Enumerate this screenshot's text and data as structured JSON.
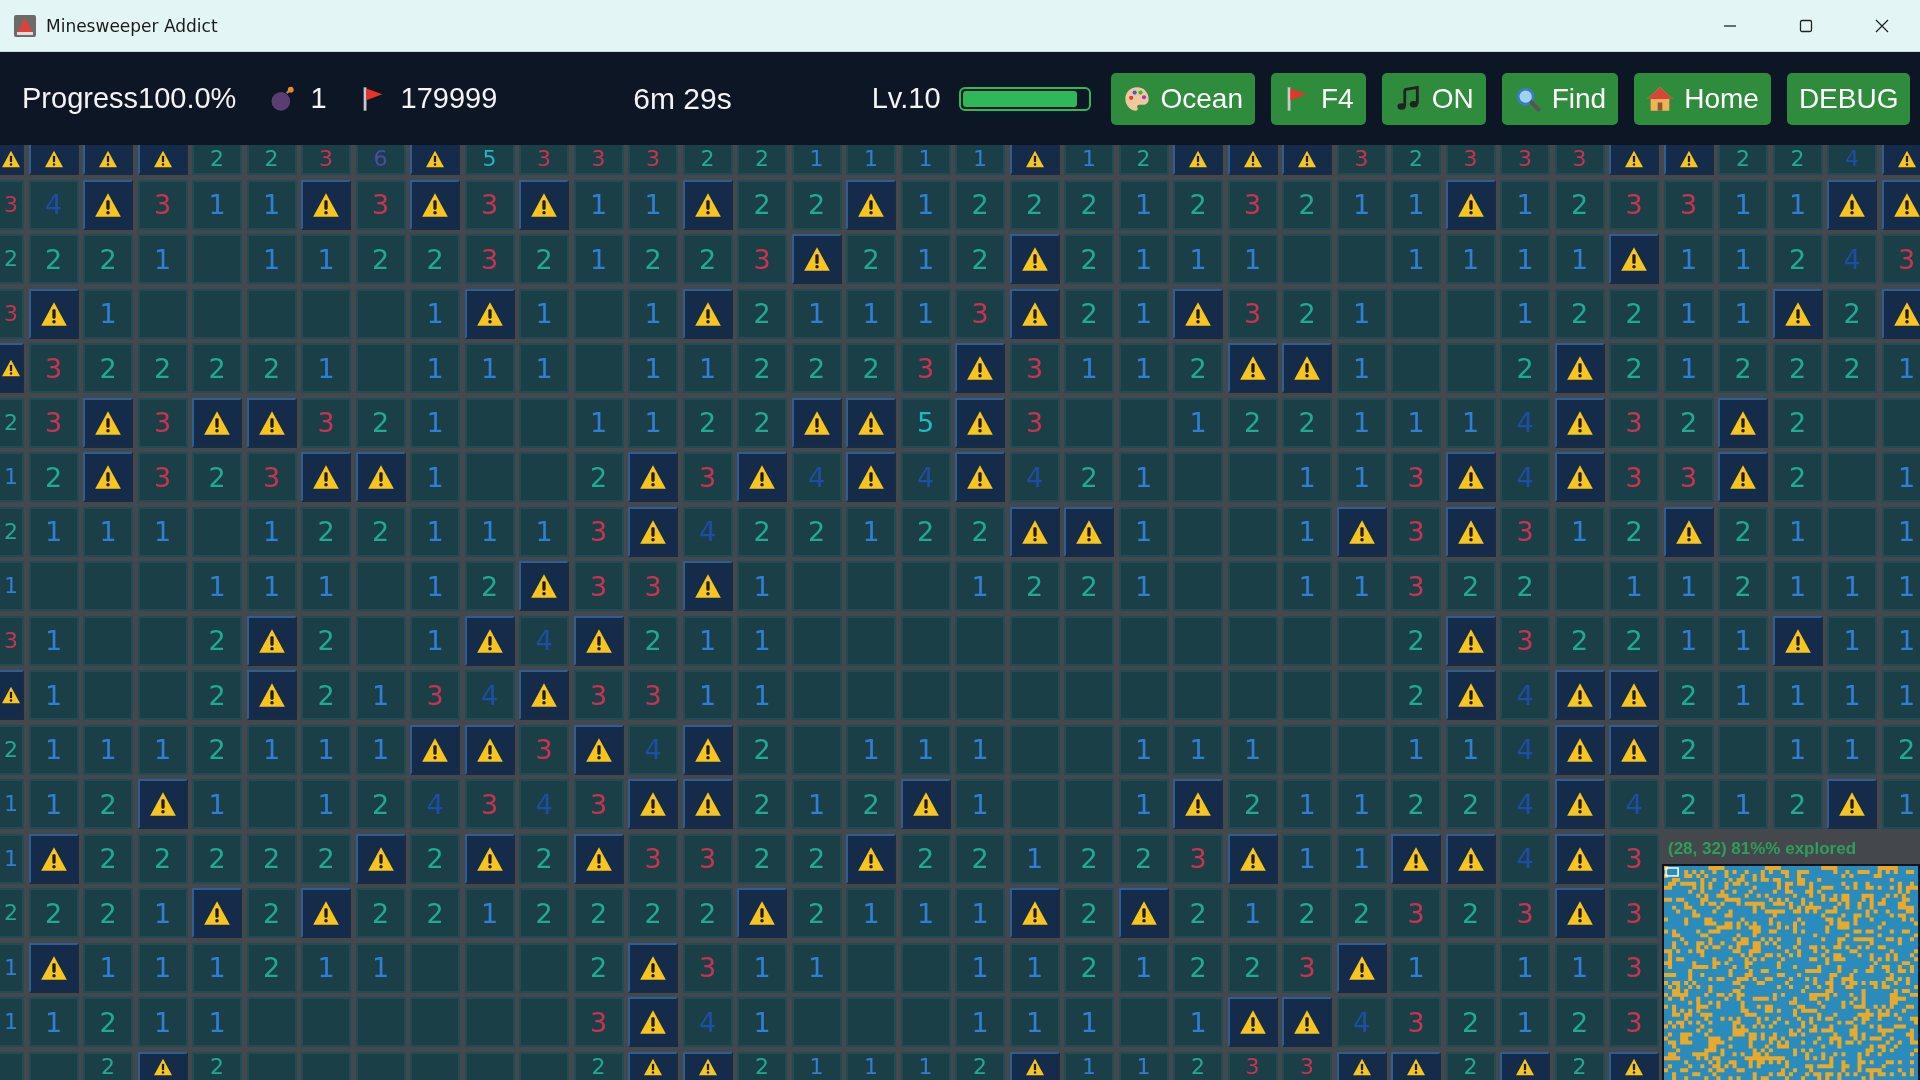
{
  "window": {
    "title": "Minesweeper Addict"
  },
  "toolbar": {
    "progress": "Progress100.0%",
    "mines": "1",
    "flags": "179999",
    "timer": "6m 29s",
    "level_label": "Lv.10",
    "level_bar": {
      "level": 0.92
    },
    "buttons": [
      {
        "kind": "theme",
        "label": "Ocean"
      },
      {
        "kind": "flag",
        "label": "F4"
      },
      {
        "kind": "music",
        "label": "ON"
      },
      {
        "kind": "find",
        "label": "Find"
      },
      {
        "kind": "home",
        "label": "Home"
      },
      {
        "kind": "debug",
        "label": "DEBUG"
      }
    ]
  },
  "board": {
    "rows": [
      [
        {
          "kind": "mine"
        },
        {
          "kind": "mine"
        },
        {
          "kind": "mine"
        },
        {
          "kind": "mine"
        },
        "2",
        "2",
        "3",
        "6",
        {
          "kind": "mine"
        },
        "5",
        "3",
        "3",
        "3",
        "2",
        "2",
        "1",
        "1",
        "1",
        "1",
        {
          "kind": "mine"
        },
        "1",
        "2",
        {
          "kind": "mine"
        },
        {
          "kind": "mine"
        },
        {
          "kind": "mine"
        },
        "3",
        "2",
        "3",
        "3",
        "3",
        {
          "kind": "mine"
        },
        {
          "kind": "mine"
        },
        "2",
        "2",
        "4",
        {
          "kind": "mine"
        }
      ],
      [
        "3",
        "4",
        {
          "kind": "mine"
        },
        "3",
        "1",
        "1",
        {
          "kind": "mine"
        },
        "3",
        {
          "kind": "mine"
        },
        "3",
        {
          "kind": "mine"
        },
        "1",
        "1",
        {
          "kind": "mine"
        },
        "2",
        "2",
        {
          "kind": "mine"
        },
        "1",
        "2",
        "2",
        "2",
        "1",
        "2",
        "3",
        "2",
        "1",
        "1",
        {
          "kind": "mine"
        },
        "1",
        "2",
        "3",
        "3",
        "1",
        "1",
        {
          "kind": "mine"
        },
        {
          "kind": "mine"
        }
      ],
      [
        "2",
        "2",
        "2",
        "1",
        {
          "kind": "empty"
        },
        "1",
        "1",
        "2",
        "2",
        "3",
        "2",
        "1",
        "2",
        "2",
        "3",
        {
          "kind": "mine"
        },
        "2",
        "1",
        "2",
        {
          "kind": "mine"
        },
        "2",
        "1",
        "1",
        "1",
        {
          "kind": "empty"
        },
        {
          "kind": "empty"
        },
        "1",
        "1",
        "1",
        "1",
        {
          "kind": "mine"
        },
        "1",
        "1",
        "2",
        "4",
        "3"
      ],
      [
        "3",
        {
          "kind": "mine"
        },
        "1",
        {
          "kind": "empty"
        },
        {
          "kind": "empty"
        },
        {
          "kind": "empty"
        },
        {
          "kind": "empty"
        },
        {
          "kind": "empty"
        },
        "1",
        {
          "kind": "mine"
        },
        "1",
        {
          "kind": "empty"
        },
        "1",
        {
          "kind": "mine"
        },
        "2",
        "1",
        "1",
        "1",
        "3",
        {
          "kind": "mine"
        },
        "2",
        "1",
        {
          "kind": "mine"
        },
        "3",
        "2",
        "1",
        {
          "kind": "empty"
        },
        {
          "kind": "empty"
        },
        "1",
        "2",
        "2",
        "1",
        "1",
        {
          "kind": "mine"
        },
        "2",
        {
          "kind": "mine"
        }
      ],
      [
        {
          "kind": "mine"
        },
        "3",
        "2",
        "2",
        "2",
        "2",
        "1",
        {
          "kind": "empty"
        },
        "1",
        "1",
        "1",
        {
          "kind": "empty"
        },
        "1",
        "1",
        "2",
        "2",
        "2",
        "3",
        {
          "kind": "mine"
        },
        "3",
        "1",
        "1",
        "2",
        {
          "kind": "mine"
        },
        {
          "kind": "mine"
        },
        "1",
        {
          "kind": "empty"
        },
        {
          "kind": "empty"
        },
        "2",
        {
          "kind": "mine"
        },
        "2",
        "1",
        "2",
        "2",
        "2",
        "1"
      ],
      [
        "2",
        "3",
        {
          "kind": "mine"
        },
        "3",
        {
          "kind": "mine"
        },
        {
          "kind": "mine"
        },
        "3",
        "2",
        "1",
        {
          "kind": "empty"
        },
        {
          "kind": "empty"
        },
        "1",
        "1",
        "2",
        "2",
        {
          "kind": "mine"
        },
        {
          "kind": "mine"
        },
        "5",
        {
          "kind": "mine"
        },
        "3",
        {
          "kind": "empty"
        },
        {
          "kind": "empty"
        },
        "1",
        "2",
        "2",
        "1",
        "1",
        "1",
        "4",
        {
          "kind": "mine"
        },
        "3",
        "2",
        {
          "kind": "mine"
        },
        "2",
        {
          "kind": "empty"
        },
        {
          "kind": "empty"
        }
      ],
      [
        "1",
        "2",
        {
          "kind": "mine"
        },
        "3",
        "2",
        "3",
        {
          "kind": "mine"
        },
        {
          "kind": "mine"
        },
        "1",
        {
          "kind": "empty"
        },
        {
          "kind": "empty"
        },
        "2",
        {
          "kind": "mine"
        },
        "3",
        {
          "kind": "mine"
        },
        "4",
        {
          "kind": "mine"
        },
        "4",
        {
          "kind": "mine"
        },
        "4",
        "2",
        "1",
        {
          "kind": "empty"
        },
        {
          "kind": "empty"
        },
        "1",
        "1",
        "3",
        {
          "kind": "mine"
        },
        "4",
        {
          "kind": "mine"
        },
        "3",
        "3",
        {
          "kind": "mine"
        },
        "2",
        {
          "kind": "empty"
        },
        "1"
      ],
      [
        "2",
        "1",
        "1",
        "1",
        {
          "kind": "empty"
        },
        "1",
        "2",
        "2",
        "1",
        "1",
        "1",
        "3",
        {
          "kind": "mine"
        },
        "4",
        "2",
        "2",
        "1",
        "2",
        "2",
        {
          "kind": "mine"
        },
        {
          "kind": "mine"
        },
        "1",
        {
          "kind": "empty"
        },
        {
          "kind": "empty"
        },
        "1",
        {
          "kind": "mine"
        },
        "3",
        {
          "kind": "mine"
        },
        "3",
        "1",
        "2",
        {
          "kind": "mine"
        },
        "2",
        "1",
        {
          "kind": "empty"
        },
        "1"
      ],
      [
        "1",
        {
          "kind": "empty"
        },
        {
          "kind": "empty"
        },
        {
          "kind": "empty"
        },
        "1",
        "1",
        "1",
        {
          "kind": "empty"
        },
        "1",
        "2",
        {
          "kind": "mine"
        },
        "3",
        "3",
        {
          "kind": "mine"
        },
        "1",
        {
          "kind": "empty"
        },
        {
          "kind": "empty"
        },
        {
          "kind": "empty"
        },
        "1",
        "2",
        "2",
        "1",
        {
          "kind": "empty"
        },
        {
          "kind": "empty"
        },
        "1",
        "1",
        "3",
        "2",
        "2",
        {
          "kind": "empty"
        },
        "1",
        "1",
        "2",
        "1",
        "1",
        "1"
      ],
      [
        "3",
        "1",
        {
          "kind": "empty"
        },
        {
          "kind": "empty"
        },
        "2",
        {
          "kind": "mine"
        },
        "2",
        {
          "kind": "empty"
        },
        "1",
        {
          "kind": "mine"
        },
        "4",
        {
          "kind": "mine"
        },
        "2",
        "1",
        "1",
        {
          "kind": "empty"
        },
        {
          "kind": "empty"
        },
        {
          "kind": "empty"
        },
        {
          "kind": "empty"
        },
        {
          "kind": "empty"
        },
        {
          "kind": "empty"
        },
        {
          "kind": "empty"
        },
        {
          "kind": "empty"
        },
        {
          "kind": "empty"
        },
        {
          "kind": "empty"
        },
        {
          "kind": "empty"
        },
        "2",
        {
          "kind": "mine"
        },
        "3",
        "2",
        "2",
        "1",
        "1",
        {
          "kind": "mine"
        },
        "1",
        "1"
      ],
      [
        {
          "kind": "mine"
        },
        "1",
        {
          "kind": "empty"
        },
        {
          "kind": "empty"
        },
        "2",
        {
          "kind": "mine"
        },
        "2",
        "1",
        "3",
        "4",
        {
          "kind": "mine"
        },
        "3",
        "3",
        "1",
        "1",
        {
          "kind": "empty"
        },
        {
          "kind": "empty"
        },
        {
          "kind": "empty"
        },
        {
          "kind": "empty"
        },
        {
          "kind": "empty"
        },
        {
          "kind": "empty"
        },
        {
          "kind": "empty"
        },
        {
          "kind": "empty"
        },
        {
          "kind": "empty"
        },
        {
          "kind": "empty"
        },
        {
          "kind": "empty"
        },
        "2",
        {
          "kind": "mine"
        },
        "4",
        {
          "kind": "mine"
        },
        {
          "kind": "mine"
        },
        "2",
        "1",
        "1",
        "1",
        "1"
      ],
      [
        "2",
        "1",
        "1",
        "1",
        "2",
        "1",
        "1",
        "1",
        {
          "kind": "mine"
        },
        {
          "kind": "mine"
        },
        "3",
        {
          "kind": "mine"
        },
        "4",
        {
          "kind": "mine"
        },
        "2",
        {
          "kind": "empty"
        },
        "1",
        "1",
        "1",
        {
          "kind": "empty"
        },
        {
          "kind": "empty"
        },
        "1",
        "1",
        "1",
        {
          "kind": "empty"
        },
        {
          "kind": "empty"
        },
        "1",
        "1",
        "4",
        {
          "kind": "mine"
        },
        {
          "kind": "mine"
        },
        "2",
        {
          "kind": "empty"
        },
        "1",
        "1",
        "2"
      ],
      [
        "1",
        "1",
        "2",
        {
          "kind": "mine"
        },
        "1",
        {
          "kind": "empty"
        },
        "1",
        "2",
        "4",
        "3",
        "4",
        "3",
        {
          "kind": "mine"
        },
        {
          "kind": "mine"
        },
        "2",
        "1",
        "2",
        {
          "kind": "mine"
        },
        "1",
        {
          "kind": "empty"
        },
        {
          "kind": "empty"
        },
        "1",
        {
          "kind": "mine"
        },
        "2",
        "1",
        "1",
        "2",
        "2",
        "4",
        {
          "kind": "mine"
        },
        "4",
        "2",
        "1",
        "2",
        {
          "kind": "mine"
        },
        "1"
      ],
      [
        "1",
        {
          "kind": "mine"
        },
        "2",
        "2",
        "2",
        "2",
        "2",
        {
          "kind": "mine"
        },
        "2",
        {
          "kind": "mine"
        },
        "2",
        {
          "kind": "mine"
        },
        "3",
        "3",
        "2",
        "2",
        {
          "kind": "mine"
        },
        "2",
        "2",
        "1",
        "2",
        "2",
        "3",
        {
          "kind": "mine"
        },
        "1",
        "1",
        {
          "kind": "mine"
        },
        {
          "kind": "mine"
        },
        "4",
        {
          "kind": "mine"
        },
        "3"
      ],
      [
        "2",
        "2",
        "2",
        "1",
        {
          "kind": "mine"
        },
        "2",
        {
          "kind": "mine"
        },
        "2",
        "2",
        "1",
        "2",
        "2",
        "2",
        "2",
        {
          "kind": "mine"
        },
        "2",
        "1",
        "1",
        "1",
        {
          "kind": "mine"
        },
        "2",
        {
          "kind": "mine"
        },
        "2",
        "1",
        "2",
        "2",
        "3",
        "2",
        "3",
        {
          "kind": "mine"
        },
        "3"
      ],
      [
        "1",
        {
          "kind": "mine"
        },
        "1",
        "1",
        "1",
        "2",
        "1",
        "1",
        {
          "kind": "empty"
        },
        {
          "kind": "empty"
        },
        {
          "kind": "empty"
        },
        "2",
        {
          "kind": "mine"
        },
        "3",
        "1",
        "1",
        {
          "kind": "empty"
        },
        {
          "kind": "empty"
        },
        "1",
        "1",
        "2",
        "1",
        "2",
        "2",
        "3",
        {
          "kind": "mine"
        },
        "1",
        {
          "kind": "empty"
        },
        "1",
        "1",
        "3"
      ],
      [
        "1",
        "1",
        "2",
        "1",
        "1",
        {
          "kind": "empty"
        },
        {
          "kind": "empty"
        },
        {
          "kind": "empty"
        },
        {
          "kind": "empty"
        },
        {
          "kind": "empty"
        },
        {
          "kind": "empty"
        },
        "3",
        {
          "kind": "mine"
        },
        "4",
        "1",
        {
          "kind": "empty"
        },
        {
          "kind": "empty"
        },
        {
          "kind": "empty"
        },
        "1",
        "1",
        "1",
        {
          "kind": "empty"
        },
        "1",
        {
          "kind": "mine"
        },
        {
          "kind": "mine"
        },
        "4",
        "3",
        "2",
        "1",
        "2",
        "3"
      ],
      [
        {
          "kind": "empty"
        },
        {
          "kind": "empty"
        },
        "2",
        {
          "kind": "mine"
        },
        "2",
        {
          "kind": "empty"
        },
        {
          "kind": "empty"
        },
        {
          "kind": "empty"
        },
        {
          "kind": "empty"
        },
        {
          "kind": "empty"
        },
        {
          "kind": "empty"
        },
        "2",
        {
          "kind": "mine"
        },
        {
          "kind": "mine"
        },
        "2",
        "1",
        "1",
        "1",
        "2",
        {
          "kind": "mine"
        },
        "1",
        "1",
        "2",
        "3",
        "3",
        {
          "kind": "mine"
        },
        {
          "kind": "mine"
        },
        "2",
        {
          "kind": "mine"
        },
        "2",
        {
          "kind": "mine"
        }
      ]
    ]
  },
  "minimap": {
    "caption": "(28, 32)  81%% explored"
  }
}
